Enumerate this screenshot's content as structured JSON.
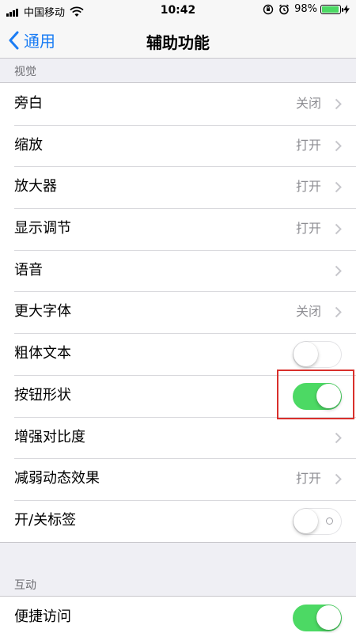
{
  "status_bar": {
    "carrier": "中国移动",
    "time": "10:42",
    "battery": "98%",
    "battery_color": "#4cd964"
  },
  "nav": {
    "back_label": "通用",
    "title": "辅助功能"
  },
  "sections": {
    "vision_header": "视觉",
    "interaction_header": "互动"
  },
  "vision_rows": [
    {
      "label": "旁白",
      "value": "关闭",
      "type": "disclosure"
    },
    {
      "label": "缩放",
      "value": "打开",
      "type": "disclosure"
    },
    {
      "label": "放大器",
      "value": "打开",
      "type": "disclosure"
    },
    {
      "label": "显示调节",
      "value": "打开",
      "type": "disclosure"
    },
    {
      "label": "语音",
      "value": "",
      "type": "disclosure"
    },
    {
      "label": "更大字体",
      "value": "关闭",
      "type": "disclosure"
    },
    {
      "label": "粗体文本",
      "type": "toggle",
      "on": false
    },
    {
      "label": "按钮形状",
      "type": "toggle",
      "on": true
    },
    {
      "label": "增强对比度",
      "value": "",
      "type": "disclosure"
    },
    {
      "label": "减弱动态效果",
      "value": "打开",
      "type": "disclosure"
    },
    {
      "label": "开/关标签",
      "type": "toggle",
      "on": false
    }
  ],
  "interaction_rows": [
    {
      "label": "便捷访问",
      "type": "toggle",
      "on": true
    }
  ],
  "colors": {
    "accent": "#1a7cf4",
    "toggle_on": "#4cd964",
    "highlight": "#d9302c"
  }
}
